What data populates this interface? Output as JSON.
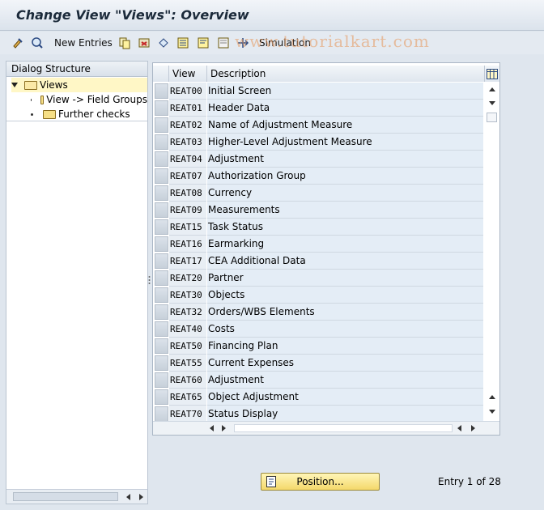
{
  "window": {
    "title": "Change View \"Views\": Overview"
  },
  "toolbar": {
    "new_entries_label": "New Entries",
    "simulation_label": "Simulation",
    "watermark": "www.tutorialkart.com"
  },
  "dialog_structure": {
    "header": "Dialog Structure",
    "items": [
      {
        "label": "Views",
        "selected": true
      },
      {
        "label": "View -> Field Groups",
        "selected": false
      },
      {
        "label": "Further checks",
        "selected": false
      }
    ]
  },
  "table": {
    "columns": [
      "View",
      "Description"
    ],
    "rows": [
      {
        "view": "REAT00",
        "description": "Initial Screen"
      },
      {
        "view": "REAT01",
        "description": "Header Data"
      },
      {
        "view": "REAT02",
        "description": "Name of Adjustment Measure"
      },
      {
        "view": "REAT03",
        "description": "Higher-Level Adjustment Measure"
      },
      {
        "view": "REAT04",
        "description": "Adjustment"
      },
      {
        "view": "REAT07",
        "description": "Authorization Group"
      },
      {
        "view": "REAT08",
        "description": "Currency"
      },
      {
        "view": "REAT09",
        "description": "Measurements"
      },
      {
        "view": "REAT15",
        "description": "Task Status"
      },
      {
        "view": "REAT16",
        "description": "Earmarking"
      },
      {
        "view": "REAT17",
        "description": "CEA Additional Data"
      },
      {
        "view": "REAT20",
        "description": "Partner"
      },
      {
        "view": "REAT30",
        "description": "Objects"
      },
      {
        "view": "REAT32",
        "description": "Orders/WBS Elements"
      },
      {
        "view": "REAT40",
        "description": "Costs"
      },
      {
        "view": "REAT50",
        "description": "Financing Plan"
      },
      {
        "view": "REAT55",
        "description": "Current Expenses"
      },
      {
        "view": "REAT60",
        "description": "Adjustment"
      },
      {
        "view": "REAT65",
        "description": "Object Adjustment"
      },
      {
        "view": "REAT70",
        "description": "Status Display"
      }
    ]
  },
  "footer": {
    "position_label": "Position...",
    "entry_info": "Entry 1 of 28"
  },
  "colors": {
    "selected_tree": "#fff7c6",
    "button_yellow": "#f4d86a"
  }
}
